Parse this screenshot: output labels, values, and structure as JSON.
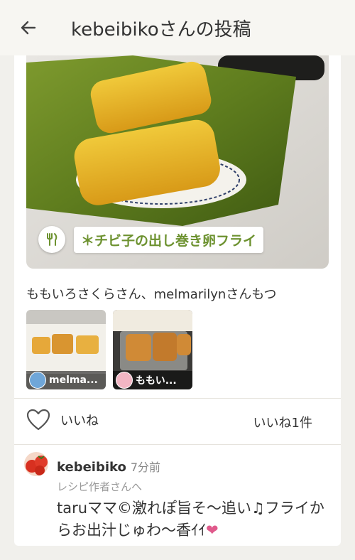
{
  "header": {
    "back_icon": "arrow-left-icon",
    "title": "kebeibikoさんの投稿"
  },
  "recipe": {
    "icon": "fork-knife-icon",
    "title": "＊チビ子の出し巻き卵フライ"
  },
  "tsukurepo": {
    "line": "ももいろさくらさん、melmarilynさんもつ",
    "thumbs": [
      {
        "name": "melma..."
      },
      {
        "name": "ももい..."
      }
    ]
  },
  "likes": {
    "label": "いいね",
    "count": "いいね1件",
    "icon": "heart-outline-icon"
  },
  "comment": {
    "user": "kebeibiko",
    "time": "7分前",
    "sub": "レシピ作者さんへ",
    "text": "taruママ©激れぽ旨そ〜追い♫フライからお出汁じゅわ〜香ｲｲ",
    "heart": "❤"
  },
  "colors": {
    "accent": "#6d9230",
    "heart": "#e05a8c",
    "header_bg": "#f7f6f2",
    "page_bg": "#f1f0ec"
  }
}
